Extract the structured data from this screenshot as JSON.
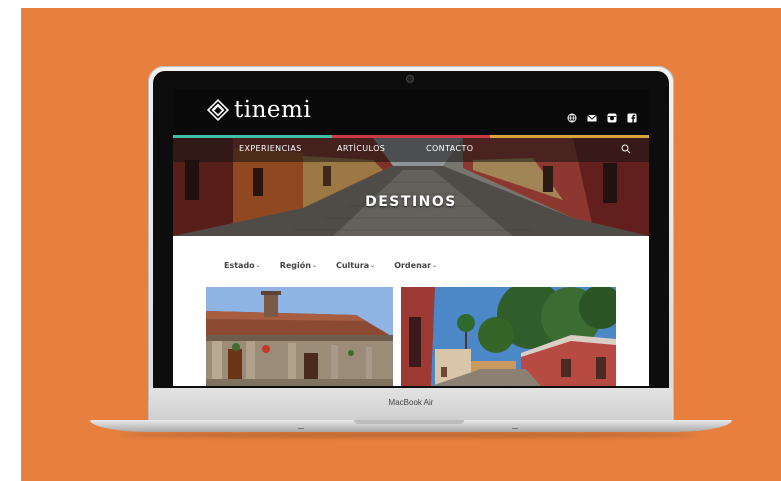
{
  "colors": {
    "background": "#E7803F",
    "topbar": "#0a0a0a",
    "stripe": [
      "#3fbfa7",
      "#c63b44",
      "#d9a440"
    ]
  },
  "laptop": {
    "model": "MacBook Air"
  },
  "site": {
    "logo_text": "tinemi",
    "social_icons": [
      "globe-icon",
      "mail-icon",
      "instagram-icon",
      "facebook-icon"
    ]
  },
  "nav": {
    "items": [
      "EXPERIENCIAS",
      "ARTÍCULOS",
      "CONTACTO"
    ]
  },
  "hero": {
    "title": "DESTINOS"
  },
  "filters": [
    {
      "label": "Estado"
    },
    {
      "label": "Región"
    },
    {
      "label": "Cultura"
    },
    {
      "label": "Ordenar"
    }
  ],
  "cards": [
    {
      "name": "card-colonial-house"
    },
    {
      "name": "card-cobbled-street"
    }
  ]
}
